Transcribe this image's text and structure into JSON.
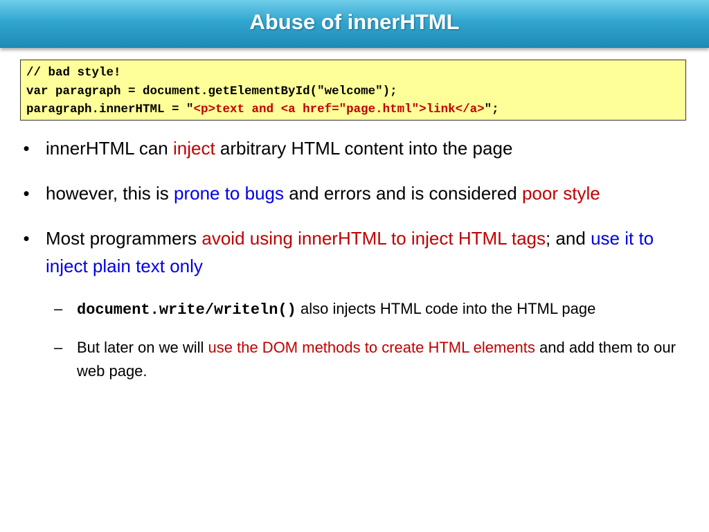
{
  "title": "Abuse of innerHTML",
  "code": {
    "line1": "// bad style!",
    "line2": "var paragraph = document.getElementById(\"welcome\");",
    "line3_prefix": "paragraph.innerHTML = \"",
    "line3_red": "<p>text and <a href=\"page.html\">link</a>",
    "line3_suffix": "\";"
  },
  "bullets": {
    "b1": {
      "t1": "innerHTML can ",
      "t2": "inject",
      "t3": " arbitrary HTML content into the page"
    },
    "b2": {
      "t1": "however, this is ",
      "t2": "prone to bugs",
      "t3": " and errors and is considered ",
      "t4": "poor style"
    },
    "b3": {
      "t1": "Most programmers ",
      "t2": "avoid using innerHTML to inject HTML tags",
      "t3": "; and ",
      "t4": "use it to inject plain text only"
    }
  },
  "subbullets": {
    "marker": "–",
    "s1": {
      "code": "document.write/writeln()",
      "t1": "  also injects HTML code into the HTML page"
    },
    "s2": {
      "t1": "But later on we will ",
      "t2": "use the DOM methods to create HTML elements",
      "t3": " and add them to our web page."
    }
  },
  "bullet_marker": "•",
  "colors": {
    "title_bar": "#31a6cf",
    "code_background": "#ffff99",
    "red_text": "#c00000",
    "blue_text": "#0000e6"
  }
}
